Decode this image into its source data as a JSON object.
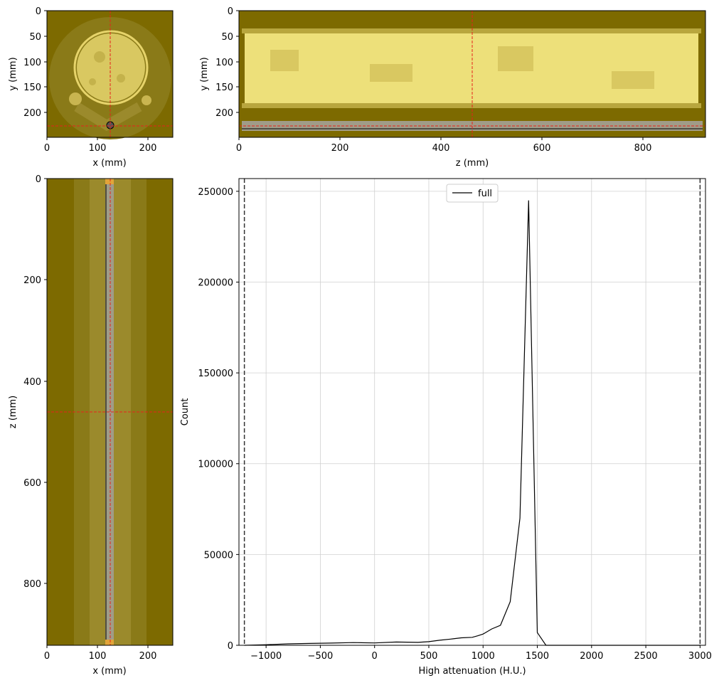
{
  "colors": {
    "background": "#7d6a00",
    "bright": "#f1df66",
    "crosshair": "#e8221a",
    "line": "#000000",
    "grid": "#d0d0d0"
  },
  "panels": {
    "axial": {
      "xlabel": "x (mm)",
      "ylabel": "y (mm)",
      "xticks": [
        "0",
        "100",
        "200"
      ],
      "yticks": [
        "0",
        "50",
        "100",
        "150",
        "200"
      ]
    },
    "sagittal": {
      "xlabel": "z (mm)",
      "ylabel": "y (mm)",
      "xticks": [
        "0",
        "200",
        "400",
        "600",
        "800"
      ],
      "yticks": [
        "0",
        "50",
        "100",
        "150",
        "200"
      ]
    },
    "coronal": {
      "xlabel": "x (mm)",
      "ylabel": "z (mm)",
      "xticks": [
        "0",
        "100",
        "200"
      ],
      "yticks": [
        "0",
        "200",
        "400",
        "600",
        "800"
      ]
    }
  },
  "chart_data": {
    "type": "line",
    "xlabel": "High attenuation (H.U.)",
    "ylabel": "Count",
    "xlim": [
      -1250,
      3050
    ],
    "ylim": [
      0,
      257000
    ],
    "xticks": [
      -1000,
      -500,
      0,
      500,
      1000,
      1500,
      2000,
      2500,
      3000
    ],
    "xtick_labels": [
      "−1000",
      "−500",
      "0",
      "500",
      "1000",
      "1500",
      "2000",
      "2500",
      "3000"
    ],
    "yticks": [
      0,
      50000,
      100000,
      150000,
      200000,
      250000
    ],
    "ytick_labels": [
      "0",
      "50000",
      "100000",
      "150000",
      "200000",
      "250000"
    ],
    "grid": true,
    "legend_position": "top-center",
    "series": [
      {
        "name": "full",
        "x": [
          -1200,
          -1000,
          -800,
          -600,
          -400,
          -200,
          0,
          200,
          400,
          500,
          600,
          700,
          800,
          900,
          950,
          1000,
          1080,
          1160,
          1250,
          1340,
          1420,
          1500,
          1580,
          2000,
          2500,
          3000
        ],
        "y": [
          0,
          300,
          800,
          1000,
          1200,
          1500,
          1300,
          1800,
          1600,
          2000,
          2800,
          3400,
          4100,
          4400,
          5200,
          6200,
          9000,
          11000,
          24000,
          70000,
          245000,
          7000,
          0,
          0,
          0,
          0
        ]
      }
    ],
    "vlines": [
      -1200,
      3000
    ]
  }
}
